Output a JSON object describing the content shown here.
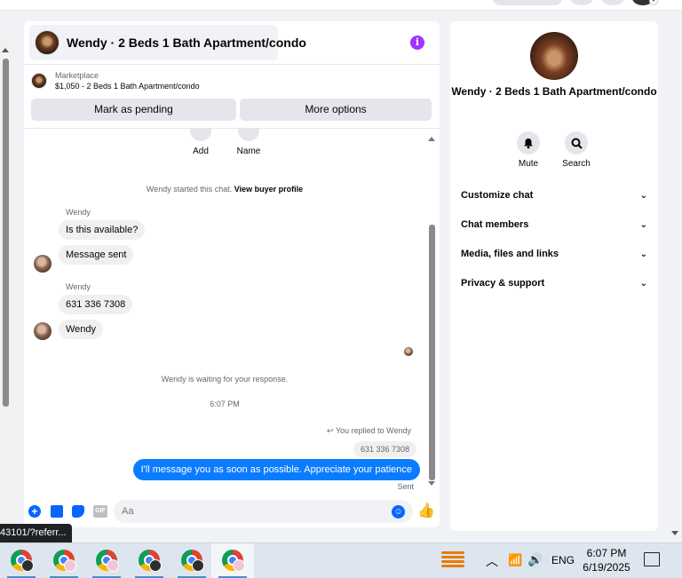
{
  "chat": {
    "title": "Wendy · 2 Beds 1 Bath Apartment/condo",
    "marketplace_label": "Marketplace",
    "marketplace_listing": "$1,050 - 2 Beds 1 Bath Apartment/condo",
    "mark_pending_label": "Mark as pending",
    "more_options_label": "More options",
    "quick_actions": [
      {
        "label": "Add"
      },
      {
        "label": "Name"
      }
    ],
    "started_text": "Wendy started this chat.",
    "view_profile_link": "View buyer profile",
    "messages": [
      {
        "sender": "Wendy",
        "text": "Is this available?"
      },
      {
        "text": "Message sent"
      },
      {
        "sender": "Wendy",
        "text": "631 336 7308"
      },
      {
        "text": "Wendy"
      }
    ],
    "waiting_text": "Wendy is waiting for your response.",
    "time_divider": "6:07 PM",
    "replied_to": "You replied to Wendy",
    "quoted_text": "631 336 7308",
    "outgoing_text": "I'll message you as soon as possible. Appreciate your patience",
    "sent_status": "Sent",
    "composer_placeholder": "Aa"
  },
  "info_panel": {
    "title": "Wendy · 2 Beds 1 Bath Apartment/condo",
    "mute_label": "Mute",
    "search_label": "Search",
    "menu": [
      {
        "label": "Customize chat"
      },
      {
        "label": "Chat members"
      },
      {
        "label": "Media, files and links"
      },
      {
        "label": "Privacy & support"
      }
    ]
  },
  "url_tooltip": "43101/?referr...",
  "taskbar": {
    "time": "6:07 PM",
    "date": "6/19/2025",
    "language": "ENG"
  },
  "colors": {
    "accent": "#0a7cff",
    "info_icon": "#a033ff",
    "bubble_gray": "#f0f0f0"
  }
}
